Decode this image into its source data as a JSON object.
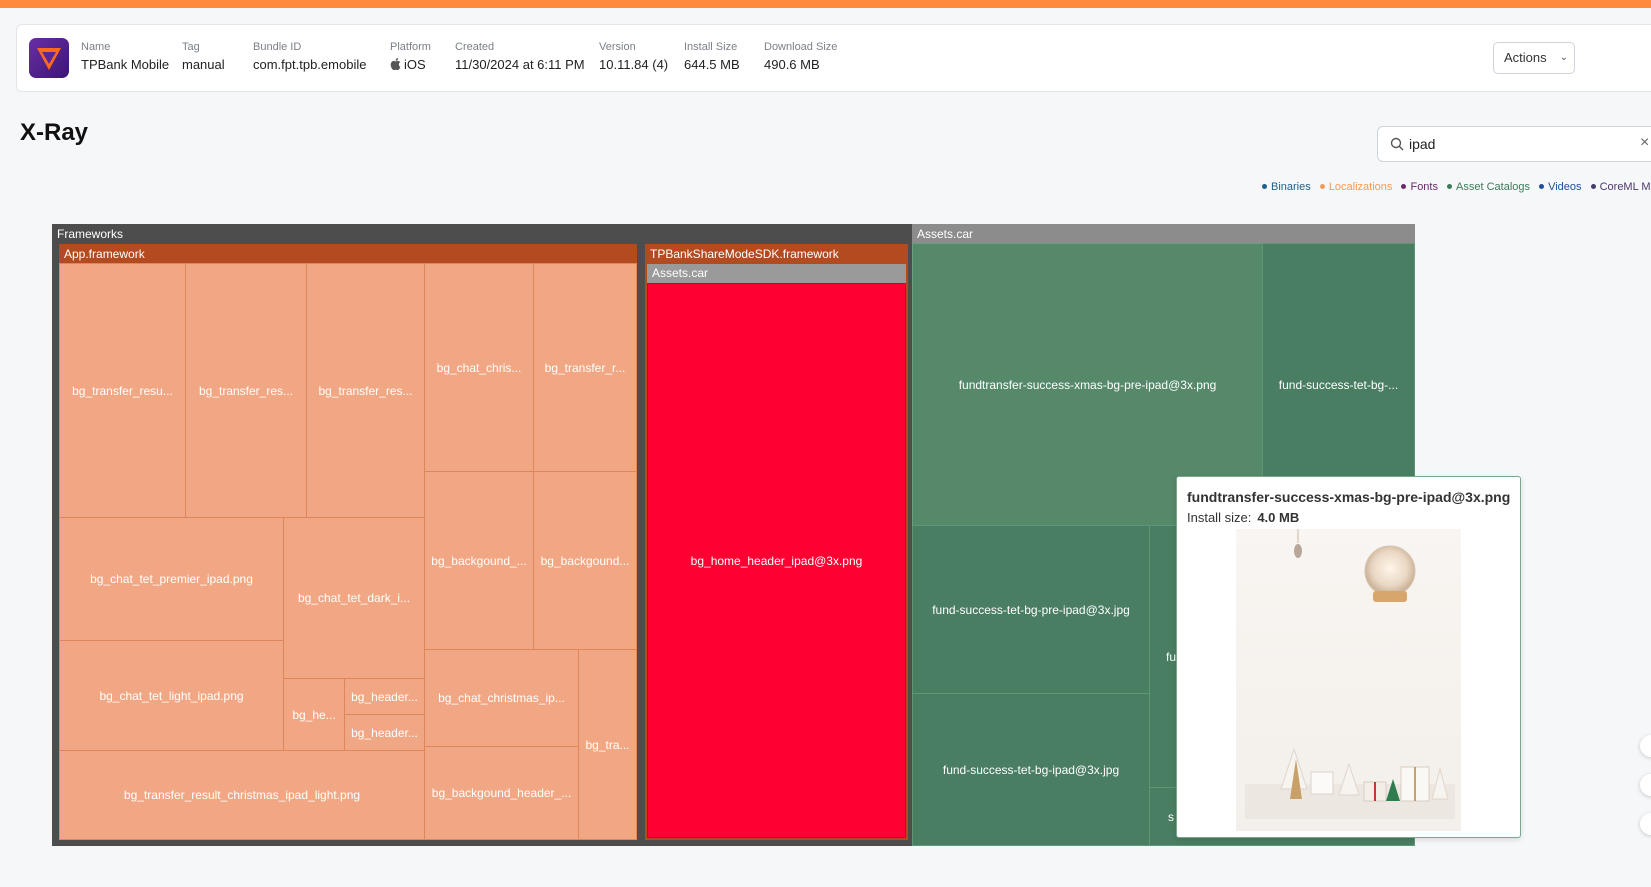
{
  "app": {
    "fields": [
      {
        "label": "Name",
        "value": "TPBank Mobile"
      },
      {
        "label": "Tag",
        "value": "manual"
      },
      {
        "label": "Bundle ID",
        "value": "com.fpt.tpb.emobile"
      },
      {
        "label": "Platform",
        "value": "iOS"
      },
      {
        "label": "Created",
        "value": "11/30/2024 at 6:11 PM"
      },
      {
        "label": "Version",
        "value": "10.11.84 (4)"
      },
      {
        "label": "Install Size",
        "value": "644.5 MB"
      },
      {
        "label": "Download Size",
        "value": "490.6 MB"
      }
    ],
    "actions_label": "Actions"
  },
  "page": {
    "title": "X-Ray"
  },
  "search": {
    "value": "ipad",
    "clear_icon": "close-icon"
  },
  "legend": [
    {
      "label": "Binaries",
      "color": "#1e5f8a"
    },
    {
      "label": "Localizations",
      "color": "#f29b5a"
    },
    {
      "label": "Fonts",
      "color": "#6b2a6b"
    },
    {
      "label": "Asset Catalogs",
      "color": "#3d7a57"
    },
    {
      "label": "Videos",
      "color": "#1f4e9c"
    },
    {
      "label": "CoreML Mod",
      "color": "#4a3a6a"
    }
  ],
  "treemap": {
    "frameworks": {
      "label": "Frameworks",
      "app_framework": {
        "label": "App.framework",
        "leaves": [
          "bg_transfer_resu...",
          "bg_transfer_res...",
          "bg_transfer_res...",
          "bg_chat_chris...",
          "bg_transfer_r...",
          "bg_backgound_...",
          "bg_backgound...",
          "bg_chat_tet_premier_ipad.png",
          "bg_chat_tet_dark_i...",
          "bg_chat_tet_light_ipad.png",
          "bg_he...",
          "bg_header...",
          "bg_header...",
          "bg_chat_christmas_ip...",
          "bg_tra...",
          "bg_transfer_result_christmas_ipad_light.png",
          "bg_backgound_header_..."
        ]
      },
      "sdk_framework": {
        "label": "TPBankShareModeSDK.framework",
        "assets_label": "Assets.car",
        "leaf": "bg_home_header_ipad@3x.png"
      }
    },
    "assets": {
      "label": "Assets.car",
      "leaves": [
        "fundtransfer-success-xmas-bg-pre-ipad@3x.png",
        "fund-success-tet-bg-...",
        "fund-success-tet-bg-pre-ipad@3x.jpg",
        "fund-success-tet-bg-ipad@3x.jpg",
        "fu",
        "s"
      ]
    }
  },
  "tooltip": {
    "title": "fundtransfer-success-xmas-bg-pre-ipad@3x.png",
    "size_label": "Install size:",
    "size_value": "4.0 MB"
  }
}
